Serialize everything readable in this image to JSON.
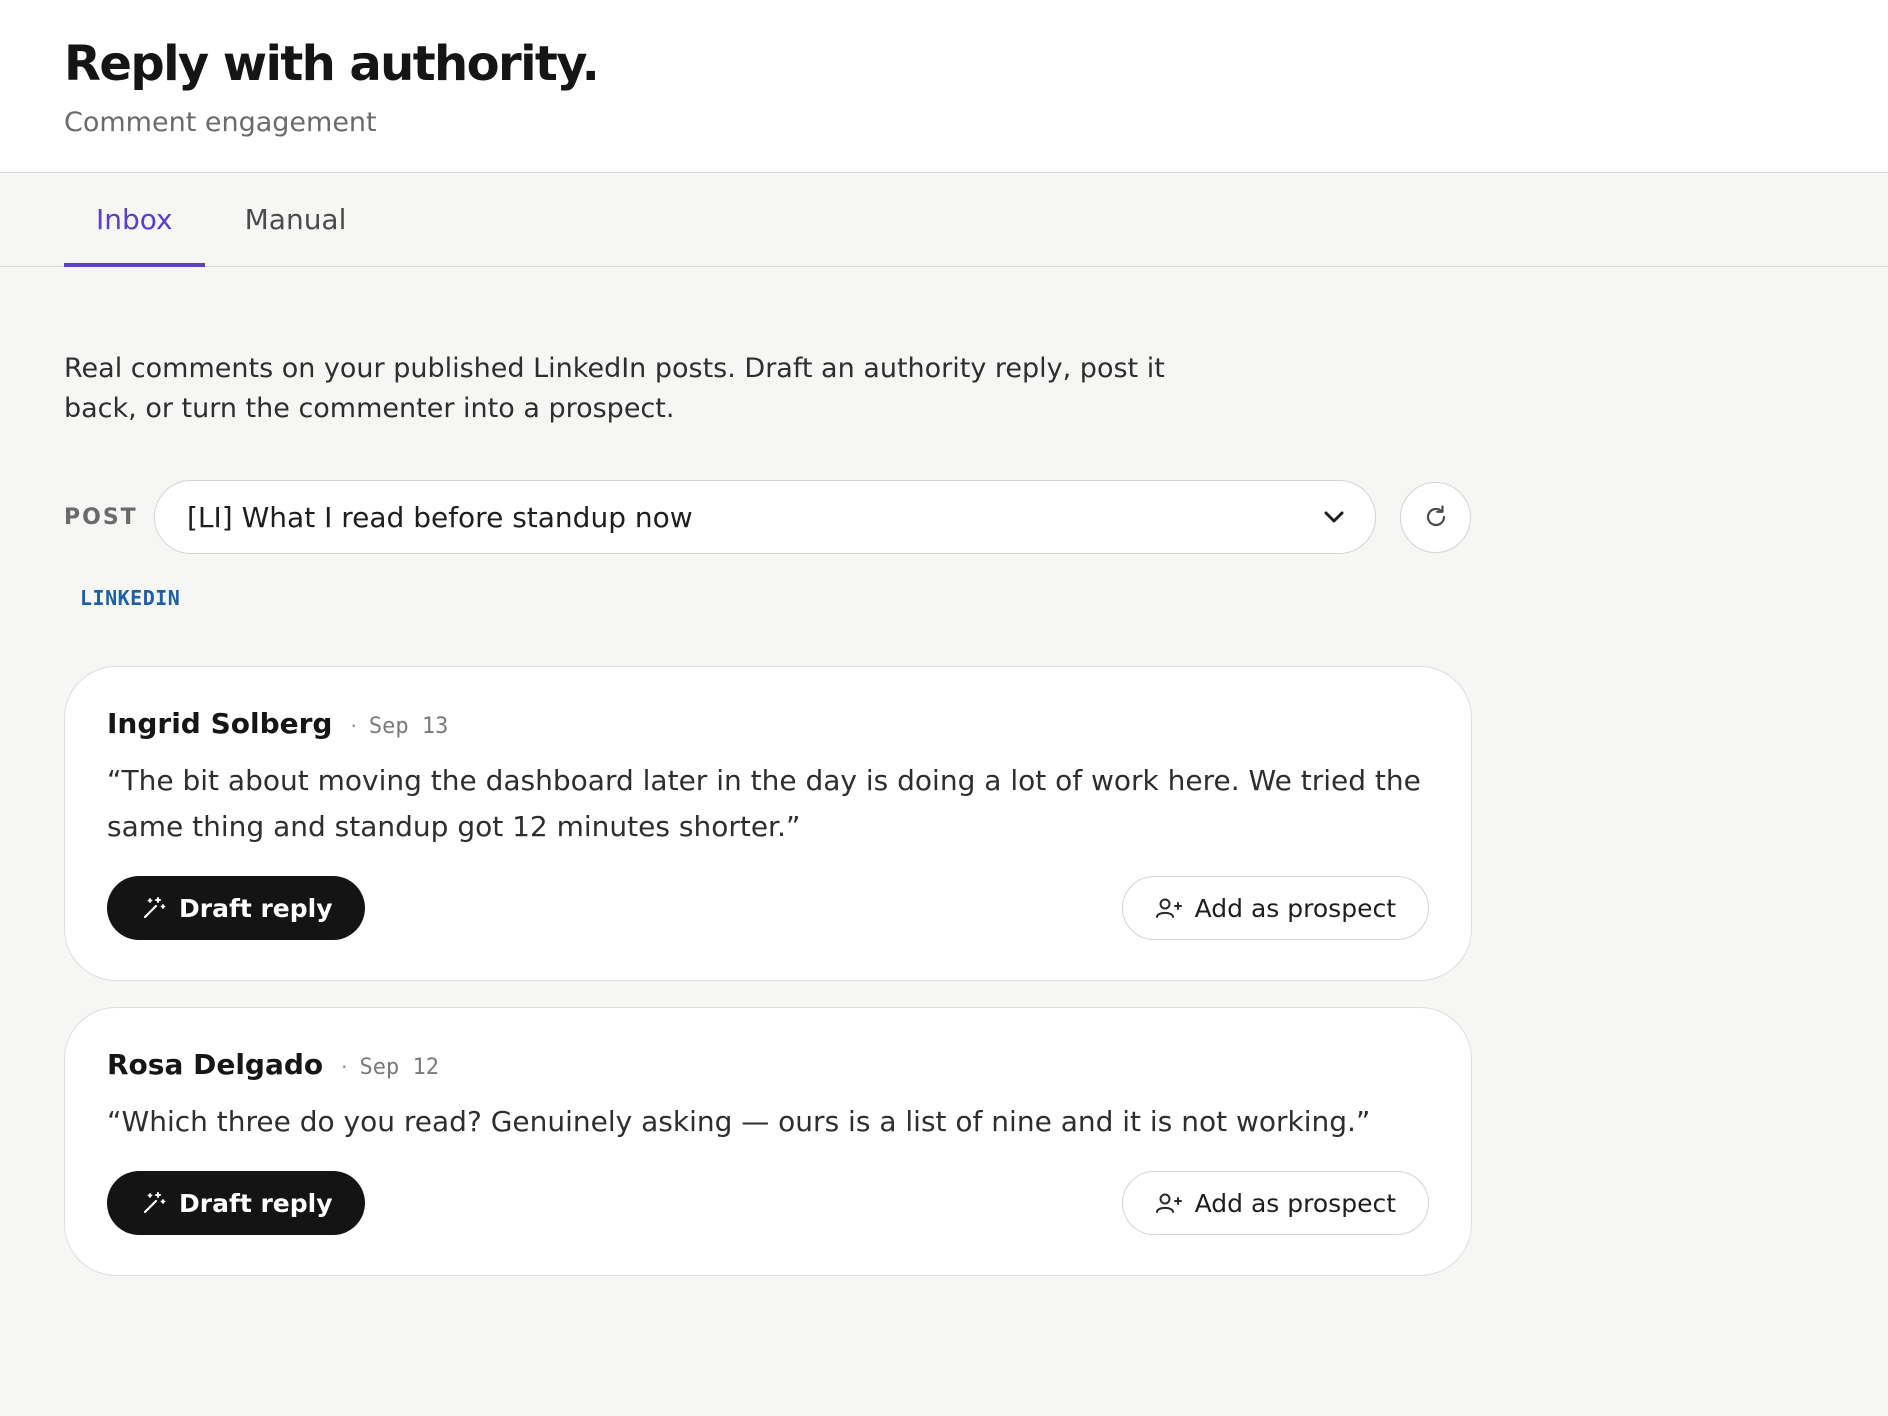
{
  "header": {
    "title": "Reply with authority.",
    "subtitle": "Comment engagement"
  },
  "tabs": [
    {
      "label": "Inbox",
      "active": true
    },
    {
      "label": "Manual",
      "active": false
    }
  ],
  "intro": "Real comments on your published LinkedIn posts. Draft an authority reply, post it back, or turn the commenter into a prospect.",
  "post_selector": {
    "label": "POST",
    "selected": "[LI] What I read before standup now"
  },
  "platform": "LINKEDIN",
  "comments": [
    {
      "author": "Ingrid Solberg",
      "date": "Sep 13",
      "text": "“The bit about moving the dashboard later in the day is doing a lot of work here. We tried the same thing and standup got 12 minutes shorter.”",
      "draft_label": "Draft reply",
      "prospect_label": "Add as prospect"
    },
    {
      "author": "Rosa Delgado",
      "date": "Sep 12",
      "text": "“Which three do you read? Genuinely asking — ours is a list of nine and it is not working.”",
      "draft_label": "Draft reply",
      "prospect_label": "Add as prospect"
    }
  ],
  "icons": {
    "draft": "magic-wand-icon",
    "prospect": "user-plus-icon",
    "refresh": "refresh-icon",
    "dropdown": "chevron-down-icon"
  },
  "colors": {
    "accent": "#5b3fc4",
    "platform": "#1b5fa6",
    "primary_button": "#141414"
  }
}
